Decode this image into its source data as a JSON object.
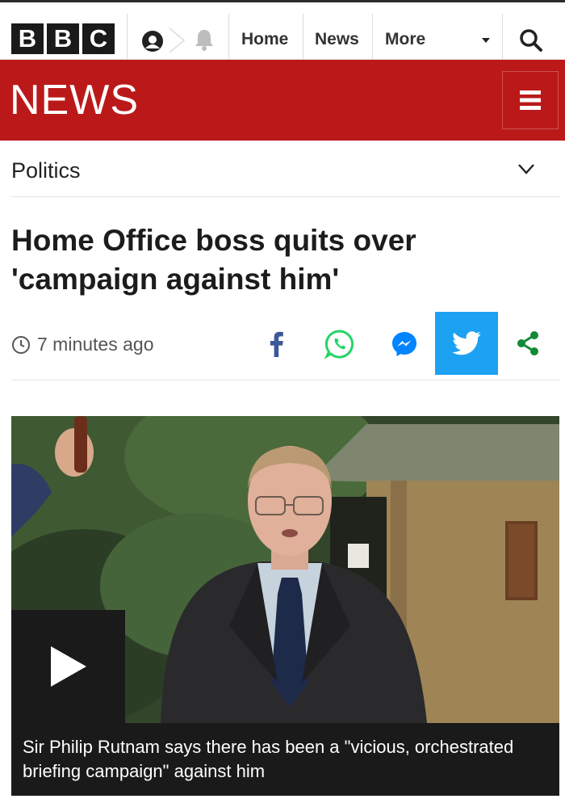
{
  "topnav": {
    "logo_letters": [
      "B",
      "B",
      "C"
    ],
    "links": [
      {
        "label": "Home"
      },
      {
        "label": "News"
      },
      {
        "label": "More"
      }
    ],
    "icons": [
      "account-icon",
      "notification-bell-icon",
      "search-icon"
    ]
  },
  "newsbar": {
    "title": "NEWS",
    "background": "#bb1919",
    "menu_icon": "hamburger-menu-icon"
  },
  "section": {
    "label": "Politics",
    "icon": "chevron-down-icon"
  },
  "article": {
    "headline": "Home Office boss quits over 'campaign against him'",
    "timestamp": "7 minutes ago",
    "share": {
      "icons": [
        "facebook-icon",
        "whatsapp-icon",
        "messenger-icon",
        "twitter-icon",
        "share-icon"
      ],
      "twitter_color": "#1da1f2",
      "facebook_color": "#3b5998",
      "whatsapp_color": "#25d366",
      "messenger_color": "#0084ff",
      "share_color": "#138a36"
    },
    "media": {
      "type": "video",
      "play_icon": "play-icon",
      "caption": "Sir Philip Rutnam says there has been a \"vicious, orchestrated briefing campaign\" against him"
    }
  }
}
